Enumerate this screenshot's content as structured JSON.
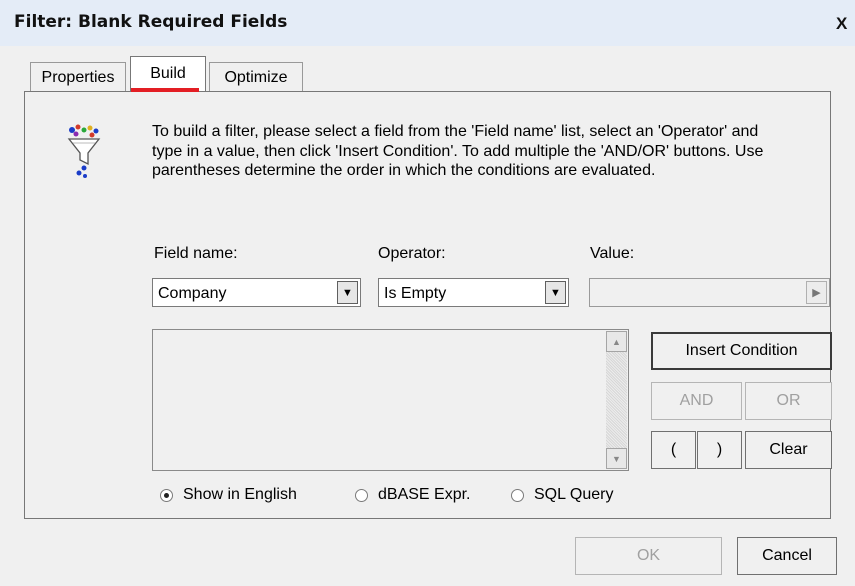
{
  "window": {
    "title": "Filter: Blank Required Fields",
    "close_label": "X"
  },
  "tabs": [
    {
      "label": "Properties"
    },
    {
      "label": "Build"
    },
    {
      "label": "Optimize"
    }
  ],
  "active_tab": "Build",
  "accent_color": "#e31e24",
  "icon": "filter-funnel-icon",
  "instructions": "To build a filter, please select a field from the 'Field name' list, select an 'Operator'  and type in a value, then click 'Insert Condition'. To add multiple the 'AND/OR' buttons.  Use parentheses determine the order in which the conditions are evaluated.",
  "fields": {
    "field_name": {
      "label": "Field name:",
      "value": "Company"
    },
    "operator": {
      "label": "Operator:",
      "value": "Is Empty"
    },
    "value": {
      "label": "Value:",
      "value": ""
    }
  },
  "condition_text": "",
  "buttons": {
    "insert_condition": "Insert Condition",
    "and": "AND",
    "or": "OR",
    "open_paren": "(",
    "close_paren": ")",
    "clear": "Clear",
    "ok": "OK",
    "cancel": "Cancel"
  },
  "display_mode": {
    "options": [
      "Show in English",
      "dBASE Expr.",
      "SQL Query"
    ],
    "selected": "Show in English"
  }
}
